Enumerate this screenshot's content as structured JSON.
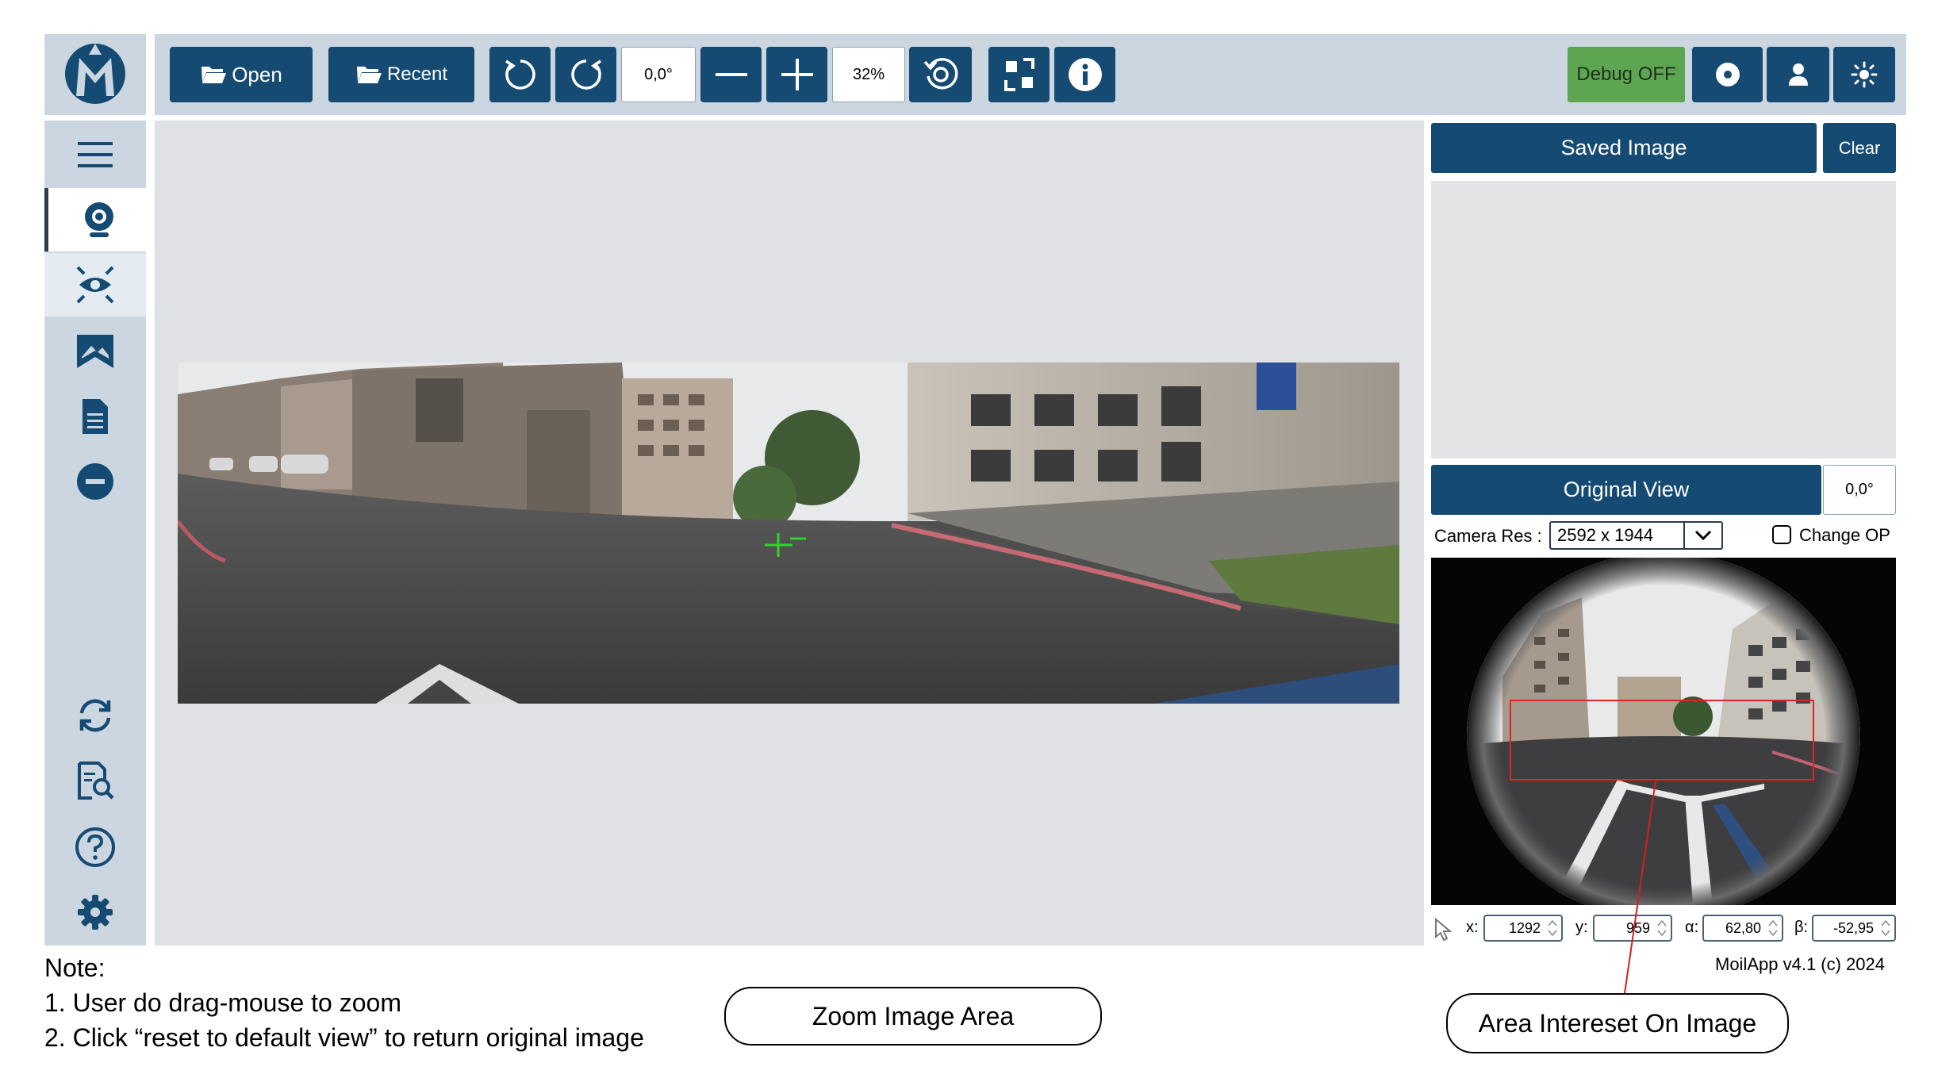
{
  "toolbar": {
    "open_label": "Open",
    "recent_label": "Recent",
    "rotation_value": "0,0°",
    "zoom_value": "32%",
    "debug_label": "Debug OFF"
  },
  "sidebar": {
    "items": [
      {
        "icon": "menu-icon"
      },
      {
        "icon": "webcam-icon"
      },
      {
        "icon": "anypoint-icon"
      },
      {
        "icon": "panorama-icon"
      },
      {
        "icon": "document-icon"
      },
      {
        "icon": "minus-circle-icon"
      },
      {
        "icon": "refresh-icon"
      },
      {
        "icon": "search-document-icon"
      },
      {
        "icon": "help-icon"
      },
      {
        "icon": "settings-icon"
      }
    ]
  },
  "right_panel": {
    "saved_image_title": "Saved Image",
    "clear_label": "Clear",
    "original_view_title": "Original View",
    "original_rotation": "0,0°",
    "camera_res_label": "Camera Res :",
    "camera_res_value": "2592 x 1944",
    "change_op_label": "Change OP",
    "coords": {
      "x_label": "x:",
      "x_value": "1292",
      "y_label": "y:",
      "y_value": "959",
      "alpha_label": "α:",
      "alpha_value": "62,80",
      "beta_label": "β:",
      "beta_value": "-52,95"
    },
    "version": "MoilApp v4.1 (c) 2024"
  },
  "notes": {
    "title": "Note:",
    "line1": "1.  User do drag-mouse to zoom",
    "line2": "2. Click “reset to default view” to return original image"
  },
  "callouts": {
    "zoom_area": "Zoom Image Area",
    "area_interest": "Area Intereset On Image"
  },
  "colors": {
    "toolbar_bg": "#cbd6e0",
    "button_bg": "#154a72",
    "debug_bg": "#5ea552",
    "main_bg": "#dfe1e4"
  }
}
